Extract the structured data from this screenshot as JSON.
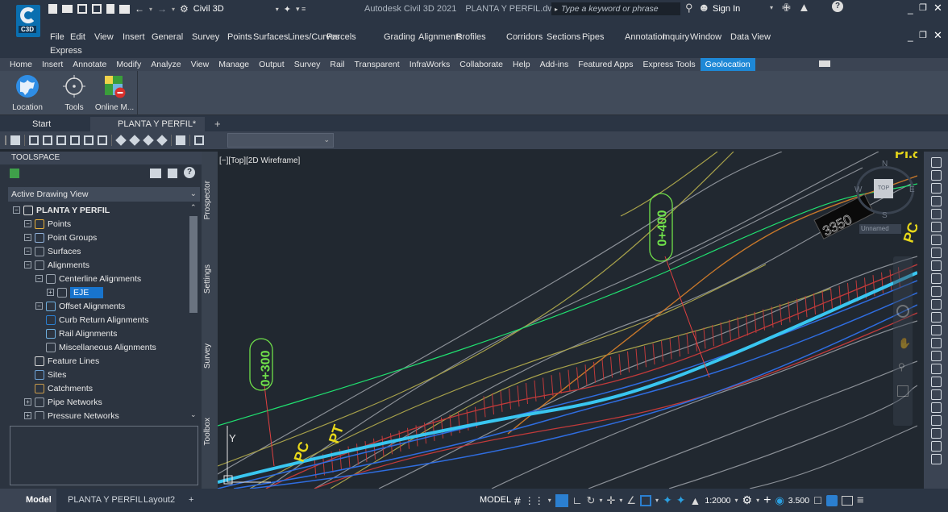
{
  "app": {
    "title": "Autodesk Civil 3D 2021",
    "filename": "PLANTA Y PERFIL.dwg",
    "workspace": "Civil 3D",
    "search_placeholder": "Type a keyword or phrase",
    "signin_label": "Sign In",
    "logo_text": "C3D"
  },
  "menubar": {
    "items": [
      "File",
      "Edit",
      "View",
      "Insert",
      "General",
      "Survey",
      "Points",
      "Surfaces",
      "Lines/Curves",
      "Parcels",
      "Grading",
      "Alignments",
      "Profiles",
      "Corridors",
      "Sections",
      "Pipes",
      "Annotation",
      "Inquiry",
      "Window",
      "Data View"
    ],
    "second_line": "Express"
  },
  "ribbon_tabs": {
    "items": [
      "Home",
      "Insert",
      "Annotate",
      "Modify",
      "Analyze",
      "View",
      "Manage",
      "Output",
      "Survey",
      "Rail",
      "Transparent",
      "InfraWorks",
      "Collaborate",
      "Help",
      "Add-ins",
      "Featured Apps",
      "Express Tools",
      "Geolocation"
    ],
    "active": "Geolocation"
  },
  "ribbon": {
    "buttons": [
      {
        "label": "Location",
        "icon": "globe-icon"
      },
      {
        "label": "Tools",
        "icon": "target-icon"
      },
      {
        "label": "Online M...",
        "icon": "map-remove-icon"
      }
    ]
  },
  "doc_tabs": {
    "start": "Start",
    "active": "PLANTA Y PERFIL*",
    "add": "+"
  },
  "toolspace": {
    "header": "TOOLSPACE",
    "view_select": "Active Drawing View",
    "tree": [
      {
        "label": "PLANTA Y PERFIL",
        "bold": true,
        "indent": 0
      },
      {
        "label": "Points",
        "indent": 1
      },
      {
        "label": "Point Groups",
        "indent": 1
      },
      {
        "label": "Surfaces",
        "indent": 1
      },
      {
        "label": "Alignments",
        "indent": 1
      },
      {
        "label": "Centerline Alignments",
        "indent": 2
      },
      {
        "label": "EJE",
        "indent": 3,
        "selected": true
      },
      {
        "label": "Offset Alignments",
        "indent": 2
      },
      {
        "label": "Curb Return Alignments",
        "indent": 2
      },
      {
        "label": "Rail Alignments",
        "indent": 2
      },
      {
        "label": "Miscellaneous Alignments",
        "indent": 2
      },
      {
        "label": "Feature Lines",
        "indent": 1
      },
      {
        "label": "Sites",
        "indent": 1
      },
      {
        "label": "Catchments",
        "indent": 1
      },
      {
        "label": "Pipe Networks",
        "indent": 1
      },
      {
        "label": "Pressure Networks",
        "indent": 1
      }
    ],
    "side_tabs": [
      "Prospector",
      "Settings",
      "Survey",
      "Toolbox"
    ]
  },
  "viewport": {
    "label": "[−][Top][2D Wireframe]",
    "stations": [
      "0+300",
      "0+400"
    ],
    "labels_pc_pt": [
      "PC",
      "PT",
      "PC"
    ],
    "pi_label": "PI.8",
    "elev_tag": "3350",
    "viewcube": {
      "top": "TOP",
      "n": "N",
      "s": "S",
      "e": "E",
      "w": "W",
      "ucs": "Unnamed"
    },
    "axis": "Y"
  },
  "statusbar": {
    "layouts": [
      "Model",
      "PLANTA Y PERFIL",
      "Layout2"
    ],
    "model": "MODEL",
    "scale": "1:2000",
    "value": "3.500"
  }
}
